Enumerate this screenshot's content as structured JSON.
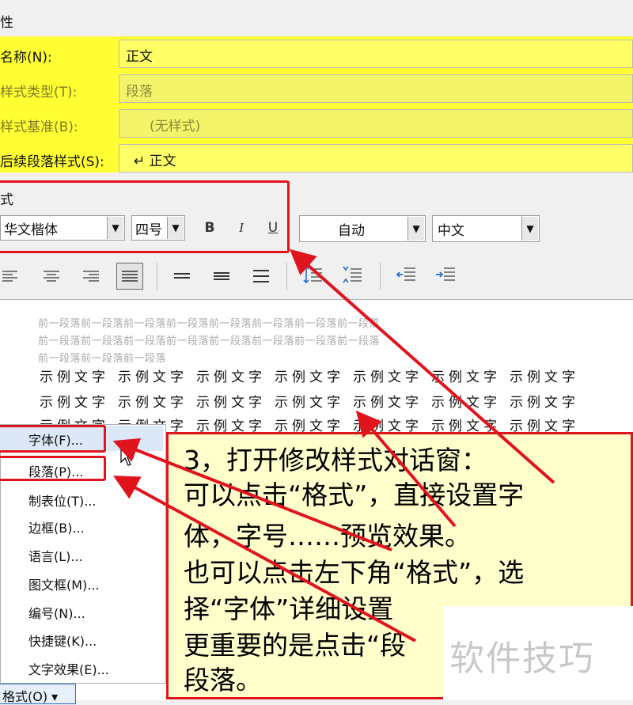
{
  "section_properties": "性",
  "properties": {
    "name_label": "名称(N):",
    "name_value": "正文",
    "type_label": "样式类型(T):",
    "type_value": "段落",
    "based_label": "样式基准(B):",
    "based_value": "(无样式)",
    "next_label": "后续段落样式(S):",
    "next_value": "↵ 正文"
  },
  "format_section": "式",
  "format": {
    "font": "华文楷体",
    "size": "四号",
    "bold": "B",
    "italic": "I",
    "underline": "U",
    "color": "自动",
    "lang": "中文"
  },
  "preview": {
    "prev_line1": "前一段落前一段落前一段落前一段落前一段落前一段落前一段落前一段落",
    "prev_line2": "前一段落前一段落前一段落前一段落前一段落前一段落前一段落前一段落",
    "prev_line3": "前一段落前一段落前一段落",
    "sample_word": "示例文字"
  },
  "menu": {
    "items": [
      "字体(F)...",
      "段落(P)...",
      "制表位(T)...",
      "边框(B)...",
      "语言(L)...",
      "图文框(M)...",
      "编号(N)...",
      "快捷键(K)...",
      "文字效果(E)..."
    ],
    "format_button": "格式(O) ▾"
  },
  "note": {
    "lines": [
      "3，打开修改样式对话窗：",
      "可以点击“格式”，直接设置字",
      "体，字号……预览效果。",
      "也可以点击左下角“格式”，选",
      "择“字体”详细设置",
      "更重要的是点击“段",
      "段落。"
    ]
  },
  "watermark": "软件技巧",
  "colors": {
    "highlight": "#ffff33",
    "annotation_red": "#e0141d",
    "note_bg": "#ffffcc"
  }
}
